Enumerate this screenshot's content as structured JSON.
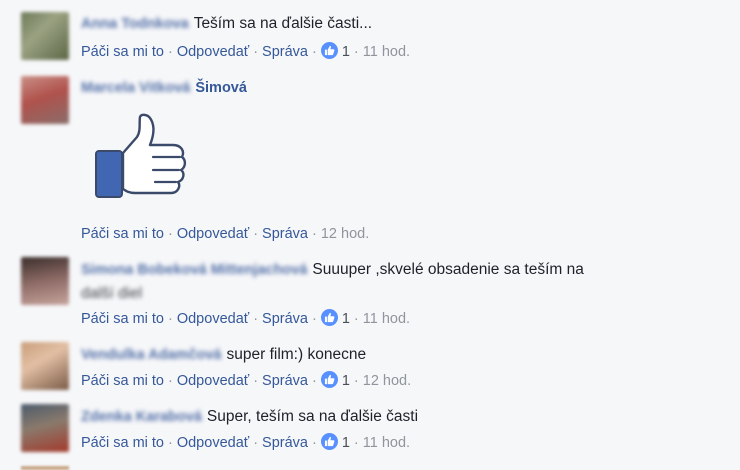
{
  "comments": [
    {
      "author_hidden": "Anna Todnkova",
      "author_visible": "",
      "text": "Teším sa na ďalšie časti...",
      "actions": {
        "like": "Páči sa mi to",
        "reply": "Odpovedať",
        "message": "Správa",
        "likes": "1",
        "time": "11 hod."
      }
    },
    {
      "author_hidden": "Marcela Vitková",
      "author_visible": "Šimová",
      "text": "",
      "actions": {
        "like": "Páči sa mi to",
        "reply": "Odpovedať",
        "message": "Správa",
        "likes": "",
        "time": "12 hod."
      }
    },
    {
      "author_hidden": "Simona Bobeková Mittenjachová",
      "author_visible": "",
      "text": "Suuuper ,skvelé obsadenie sa teším na",
      "text2": "další diel",
      "actions": {
        "like": "Páči sa mi to",
        "reply": "Odpovedať",
        "message": "Správa",
        "likes": "1",
        "time": "11 hod."
      }
    },
    {
      "author_hidden": "Vendulka Adamčová",
      "author_visible": "",
      "text": "super film:) konecne",
      "actions": {
        "like": "Páči sa mi to",
        "reply": "Odpovedať",
        "message": "Správa",
        "likes": "1",
        "time": "12 hod."
      }
    },
    {
      "author_hidden": "Zdenka Karabová",
      "author_visible": "",
      "text": "Super, teším sa na ďalšie časti",
      "actions": {
        "like": "Páči sa mi to",
        "reply": "Odpovedať",
        "message": "Správa",
        "likes": "1",
        "time": "11 hod."
      }
    }
  ],
  "colors": {
    "link": "#365899",
    "meta": "#90949c",
    "like_badge": "#5890ff",
    "thumb_cuff": "#4267b2"
  },
  "icons": {
    "like_badge": "thumbs-up-icon",
    "sticker": "large-thumbs-up-sticker"
  }
}
